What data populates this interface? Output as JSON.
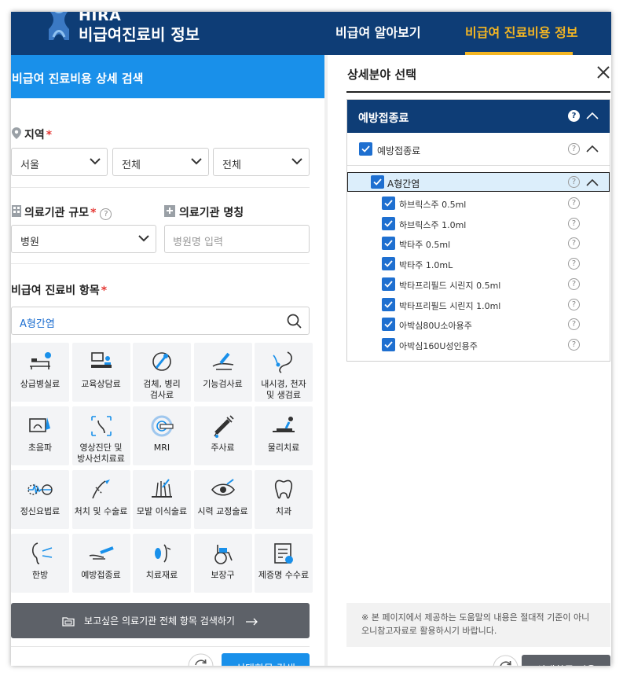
{
  "header": {
    "logo_text": "HIRA",
    "site_title": "비급여진료비 정보",
    "nav": [
      "비급여 알아보기",
      "비급여 진료비용 정보"
    ]
  },
  "left": {
    "section_title": "비급여 진료비용 상세 검색",
    "region": {
      "label": "지역",
      "required": "*",
      "selects": [
        "서울",
        "전체",
        "전체"
      ]
    },
    "scale": {
      "label": "의료기관 규모",
      "required": "*",
      "help": "?",
      "value": "병원"
    },
    "name": {
      "label": "의료기관 명칭",
      "placeholder": "병원명 입력"
    },
    "items": {
      "label": "비급여 진료비 항목",
      "required": "*",
      "search_value": "A형간염"
    },
    "categories": [
      {
        "label": "상급병실료",
        "icon": "hospital-bed-icon"
      },
      {
        "label": "교육상담료",
        "icon": "counseling-icon"
      },
      {
        "label": "검체, 병리\n검사료",
        "icon": "specimen-icon"
      },
      {
        "label": "기능검사료",
        "icon": "function-test-icon"
      },
      {
        "label": "내시경, 천자\n및 생검료",
        "icon": "endoscope-icon"
      },
      {
        "label": "초음파",
        "icon": "ultrasound-icon"
      },
      {
        "label": "영상진단 및\n방사선치료료",
        "icon": "imaging-icon"
      },
      {
        "label": "MRI",
        "icon": "mri-icon"
      },
      {
        "label": "주사료",
        "icon": "syringe-icon"
      },
      {
        "label": "물리치료",
        "icon": "physiotherapy-icon"
      },
      {
        "label": "정신요법료",
        "icon": "brainwave-icon"
      },
      {
        "label": "처치 및 수술료",
        "icon": "surgery-icon"
      },
      {
        "label": "모발 이식술료",
        "icon": "hair-transplant-icon"
      },
      {
        "label": "시력 교정술료",
        "icon": "eye-icon"
      },
      {
        "label": "치과",
        "icon": "tooth-icon"
      },
      {
        "label": "한방",
        "icon": "acupuncture-icon"
      },
      {
        "label": "예방접종료",
        "icon": "vaccination-icon"
      },
      {
        "label": "치료재료",
        "icon": "treatment-material-icon"
      },
      {
        "label": "보장구",
        "icon": "wheelchair-icon"
      },
      {
        "label": "제증명 수수료",
        "icon": "certificate-icon"
      }
    ],
    "bulk_search_button": "보고싶은 의료기관 전체 항목 검색하기",
    "search_button": "선택항목 검색"
  },
  "right": {
    "title": "상세분야 선택",
    "group_title": "예방접종료",
    "sub_group": "예방접종료",
    "disease": "A형간염",
    "vaccines": [
      "하브릭스주 0.5ml",
      "하브릭스주 1.0ml",
      "박타주 0.5ml",
      "박타주 1.0mL",
      "박타프리필드 시린지 0.5ml",
      "박타프리필드 시린지 1.0ml",
      "아박심80U소아용주",
      "아박심160U성인용주"
    ],
    "notice": "※ 본 페이지에서 제공하는 도움말의 내용은 절대적 기준이 아니\n오니참고자료로 활용하시기 바랍니다.",
    "apply_button": "선택항목 적용"
  },
  "colors": {
    "header_bg": "#0e3d76",
    "accent_blue": "#1990ea",
    "nav_active": "#f4b623",
    "required": "#e53935"
  }
}
